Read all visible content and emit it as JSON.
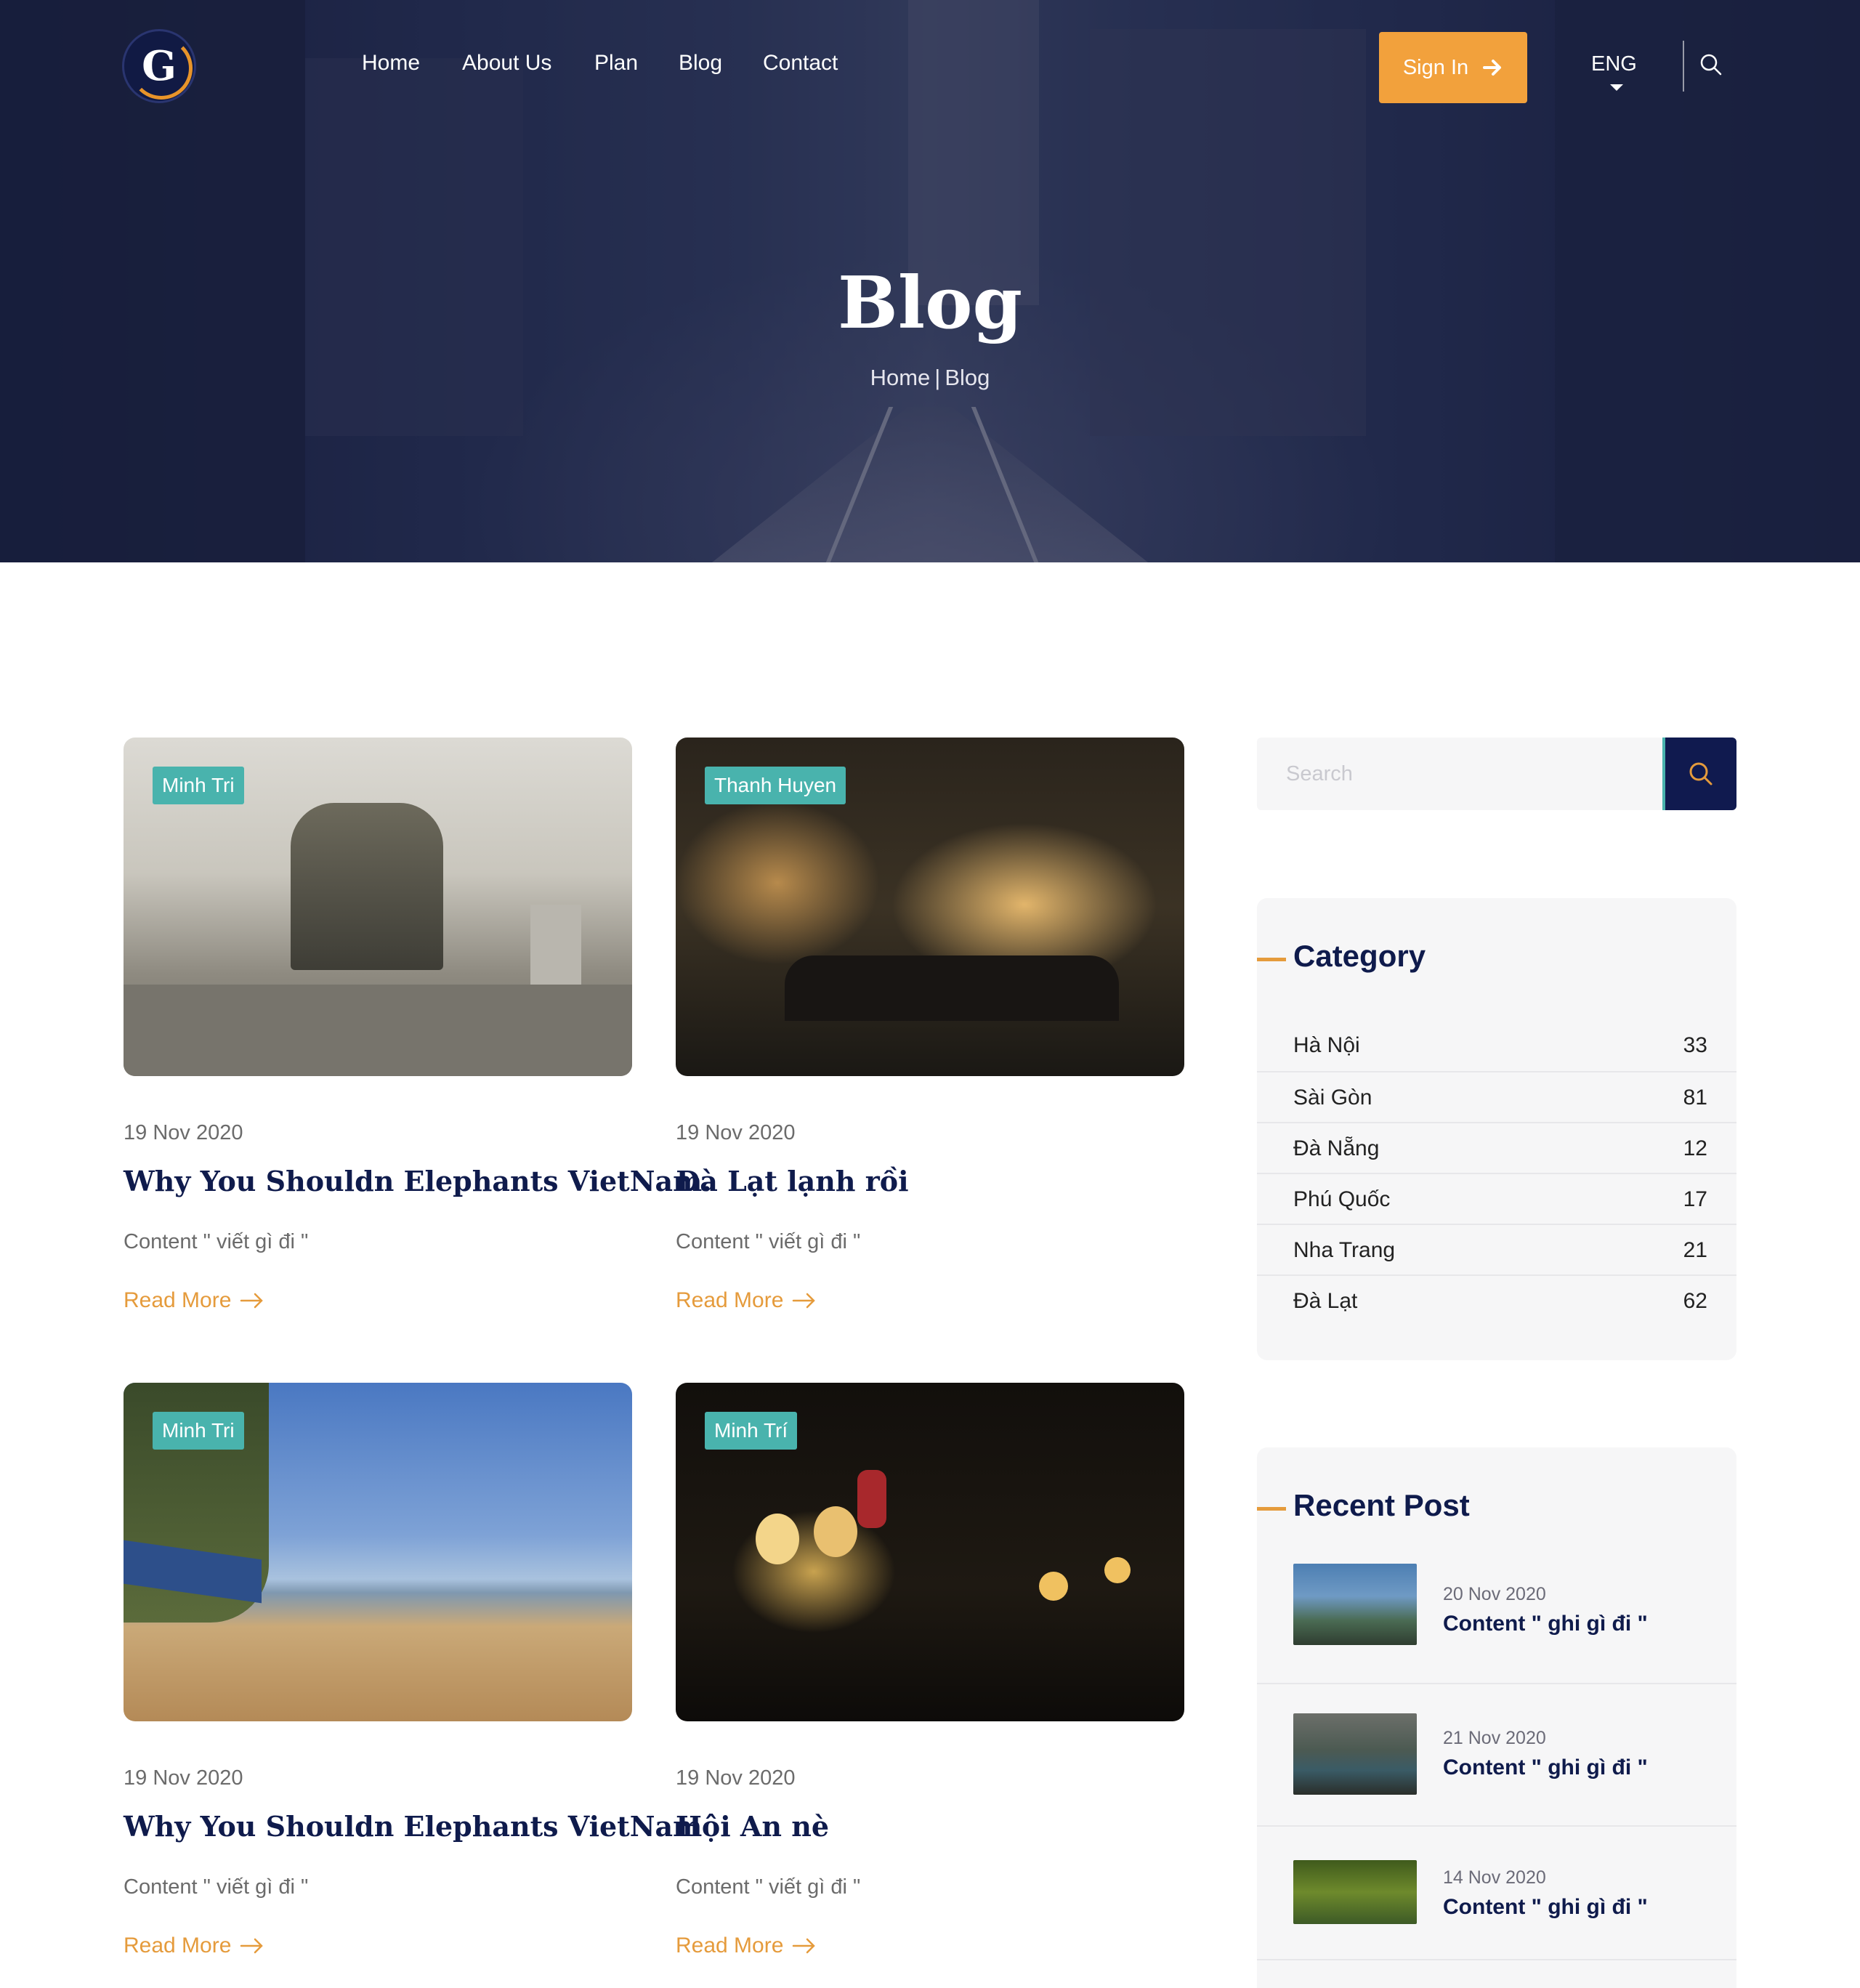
{
  "header": {
    "logo_letter": "G",
    "nav": [
      "Home",
      "About Us",
      "Plan",
      "Blog",
      "Contact"
    ],
    "signin_label": "Sign In",
    "lang": "ENG"
  },
  "hero": {
    "title": "Blog",
    "breadcrumb_home": "Home",
    "breadcrumb_sep": "|",
    "breadcrumb_current": "Blog"
  },
  "posts": [
    {
      "tag": "Minh Tri",
      "date": "19 Nov 2020",
      "title": "Why You Shouldn Elephants VietNam.",
      "excerpt": "Content \" viết gì đi \"",
      "read_more": "Read More"
    },
    {
      "tag": "Thanh Huyen",
      "date": "19 Nov 2020",
      "title": "Đà Lạt lạnh rồi",
      "excerpt": "Content \" viết gì đi \"",
      "read_more": "Read More"
    },
    {
      "tag": "Minh Tri",
      "date": "19 Nov 2020",
      "title": "Why You Shouldn Elephants VietNam",
      "excerpt": "Content \" viết gì đi \"",
      "read_more": "Read More"
    },
    {
      "tag": "Minh Trí",
      "date": "19 Nov 2020",
      "title": "Hội An nè",
      "excerpt": "Content \" viết gì đi \"",
      "read_more": "Read More"
    }
  ],
  "sidebar": {
    "search_placeholder": "Search",
    "category_title": "Category",
    "categories": [
      {
        "name": "Hà Nội",
        "count": "33"
      },
      {
        "name": "Sài Gòn",
        "count": "81"
      },
      {
        "name": "Đà Nẵng",
        "count": "12"
      },
      {
        "name": "Phú Quốc",
        "count": "17"
      },
      {
        "name": "Nha Trang",
        "count": "21"
      },
      {
        "name": "Đà Lạt",
        "count": "62"
      }
    ],
    "recent_title": "Recent Post",
    "recent": [
      {
        "date": "20 Nov 2020",
        "title": "Content \" ghi gì đi \""
      },
      {
        "date": "21 Nov 2020",
        "title": "Content \" ghi gì đi \""
      },
      {
        "date": "14 Nov 2020",
        "title": "Content \" ghi gì đi \""
      }
    ]
  },
  "colors": {
    "navy": "#0f1b4c",
    "accent_orange": "#f2a13c",
    "tag_teal": "#49b3ad"
  },
  "icons": [
    "search-icon",
    "arrow-right-icon",
    "chevron-down-icon"
  ]
}
